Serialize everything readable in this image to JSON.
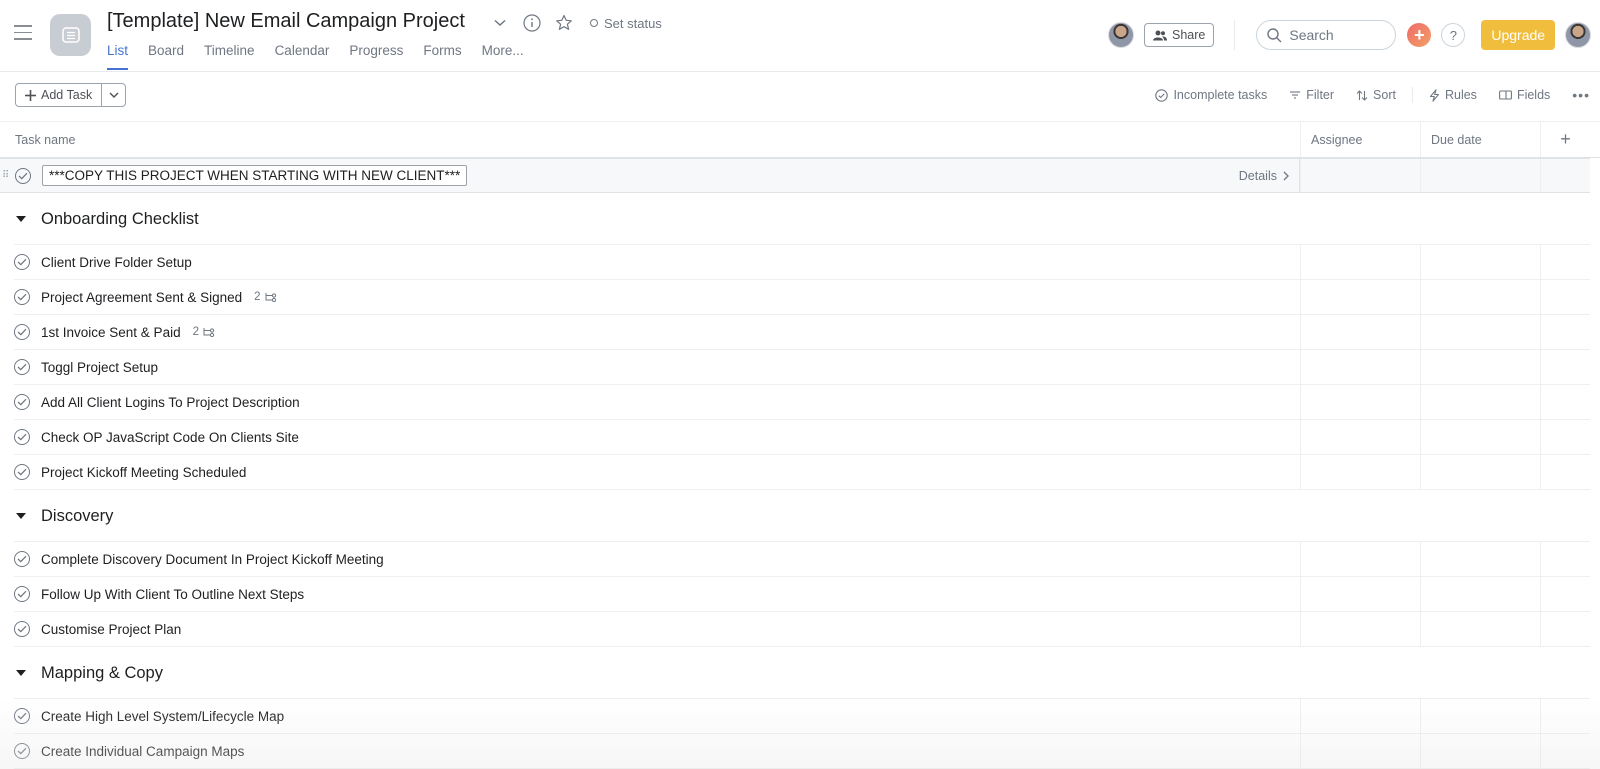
{
  "header": {
    "project_title": "[Template] New Email Campaign Project",
    "set_status_label": "Set status",
    "tabs": [
      {
        "label": "List",
        "active": true
      },
      {
        "label": "Board",
        "active": false
      },
      {
        "label": "Timeline",
        "active": false
      },
      {
        "label": "Calendar",
        "active": false
      },
      {
        "label": "Progress",
        "active": false
      },
      {
        "label": "Forms",
        "active": false
      },
      {
        "label": "More...",
        "active": false
      }
    ],
    "share_label": "Share",
    "search_placeholder": "Search",
    "upgrade_label": "Upgrade",
    "help_label": "?",
    "accent_color": "#4573d2",
    "upgrade_color": "#f1bd3d"
  },
  "toolbar": {
    "add_task_label": "Add Task",
    "incomplete_label": "Incomplete tasks",
    "filter_label": "Filter",
    "sort_label": "Sort",
    "rules_label": "Rules",
    "fields_label": "Fields",
    "more_label": "•••"
  },
  "columns": {
    "task_name": "Task name",
    "assignee": "Assignee",
    "due_date": "Due date",
    "add": "+"
  },
  "pinned_task": {
    "name": "***COPY THIS PROJECT WHEN STARTING WITH NEW CLIENT***",
    "details_label": "Details"
  },
  "sections": [
    {
      "name": "Onboarding Checklist",
      "tasks": [
        {
          "name": "Client Drive Folder Setup",
          "subtasks": null
        },
        {
          "name": "Project Agreement Sent & Signed",
          "subtasks": "2"
        },
        {
          "name": "1st Invoice Sent & Paid",
          "subtasks": "2"
        },
        {
          "name": "Toggl Project Setup",
          "subtasks": null
        },
        {
          "name": "Add All Client Logins To Project Description",
          "subtasks": null
        },
        {
          "name": "Check OP JavaScript Code On Clients Site",
          "subtasks": null
        },
        {
          "name": "Project Kickoff Meeting Scheduled",
          "subtasks": null
        }
      ]
    },
    {
      "name": "Discovery",
      "tasks": [
        {
          "name": "Complete Discovery Document In Project Kickoff Meeting",
          "subtasks": null
        },
        {
          "name": "Follow Up With Client To Outline Next Steps",
          "subtasks": null
        },
        {
          "name": "Customise Project Plan",
          "subtasks": null
        }
      ]
    },
    {
      "name": "Mapping & Copy",
      "tasks": [
        {
          "name": "Create High Level System/Lifecycle Map",
          "subtasks": null
        },
        {
          "name": "Create Individual Campaign Maps",
          "subtasks": null
        }
      ]
    }
  ]
}
